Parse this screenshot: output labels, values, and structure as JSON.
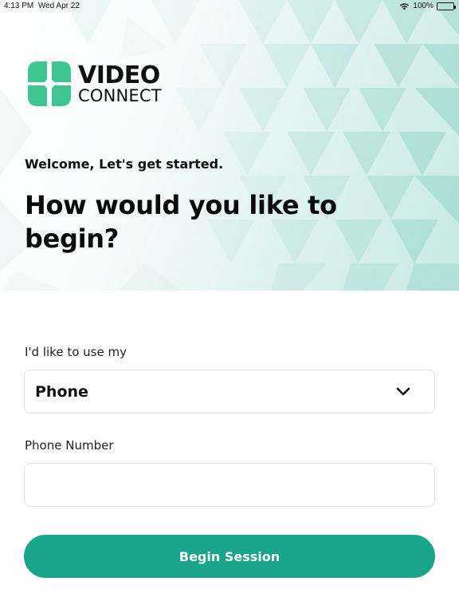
{
  "status_bar": {
    "time": "4:13 PM",
    "date": "Wed Apr 22",
    "battery": "100%",
    "wifi_icon": "wifi-icon",
    "battery_icon": "battery-icon"
  },
  "logo": {
    "line1": "VIDEO",
    "line2": "CONNECT",
    "icon": "video-connect-logo-icon"
  },
  "welcome": "Welcome, Let's get started.",
  "headline": "How would you like to begin?",
  "device_select": {
    "label": "I'd like to use my",
    "value": "Phone",
    "icon": "chevron-down-icon"
  },
  "phone_input": {
    "label": "Phone Number",
    "value": "",
    "placeholder": ""
  },
  "begin_button": {
    "label": "Begin Session"
  },
  "colors": {
    "accent": "#1aa58b",
    "logo_green": "#3fc58f",
    "hero_tint": "#c6e9e4"
  }
}
